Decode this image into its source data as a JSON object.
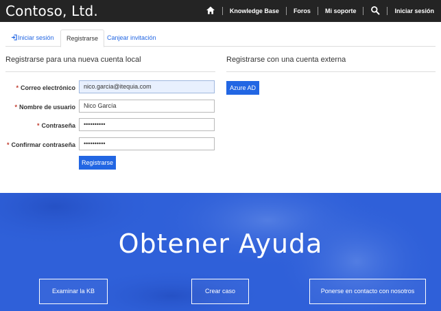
{
  "header": {
    "brand": "Contoso, Ltd.",
    "nav": {
      "home_icon": "home-icon",
      "knowledge_base": "Knowledge Base",
      "forums": "Foros",
      "my_support": "Mi soporte",
      "search_icon": "search-icon",
      "sign_in": "Iniciar sesión"
    }
  },
  "tabs": [
    {
      "label": "Iniciar sesión",
      "icon": "sign-in-icon"
    },
    {
      "label": "Registrarse"
    },
    {
      "label": "Canjear invitación"
    }
  ],
  "local": {
    "title": "Registrarse para una nueva cuenta local",
    "fields": {
      "email_label": "Correo electrónico",
      "email_value": "nico.garcia@itequia.com",
      "username_label": "Nombre de usuario",
      "username_value": "Nico García",
      "password_label": "Contraseña",
      "password_value": "••••••••••",
      "confirm_label": "Confirmar contraseña",
      "confirm_value": "••••••••••",
      "required_mark": "*"
    },
    "submit": "Registrarse"
  },
  "external": {
    "title": "Registrarse con una cuenta externa",
    "azure_button": "Azure AD"
  },
  "hero": {
    "title": "Obtener Ayuda",
    "buttons": {
      "kb": "Examinar la KB",
      "case": "Crear caso",
      "contact": "Ponerse en contacto con nosotros"
    }
  },
  "colors": {
    "topbar": "#242424",
    "accent": "#2266e3",
    "hero": "#2e5fd8"
  }
}
